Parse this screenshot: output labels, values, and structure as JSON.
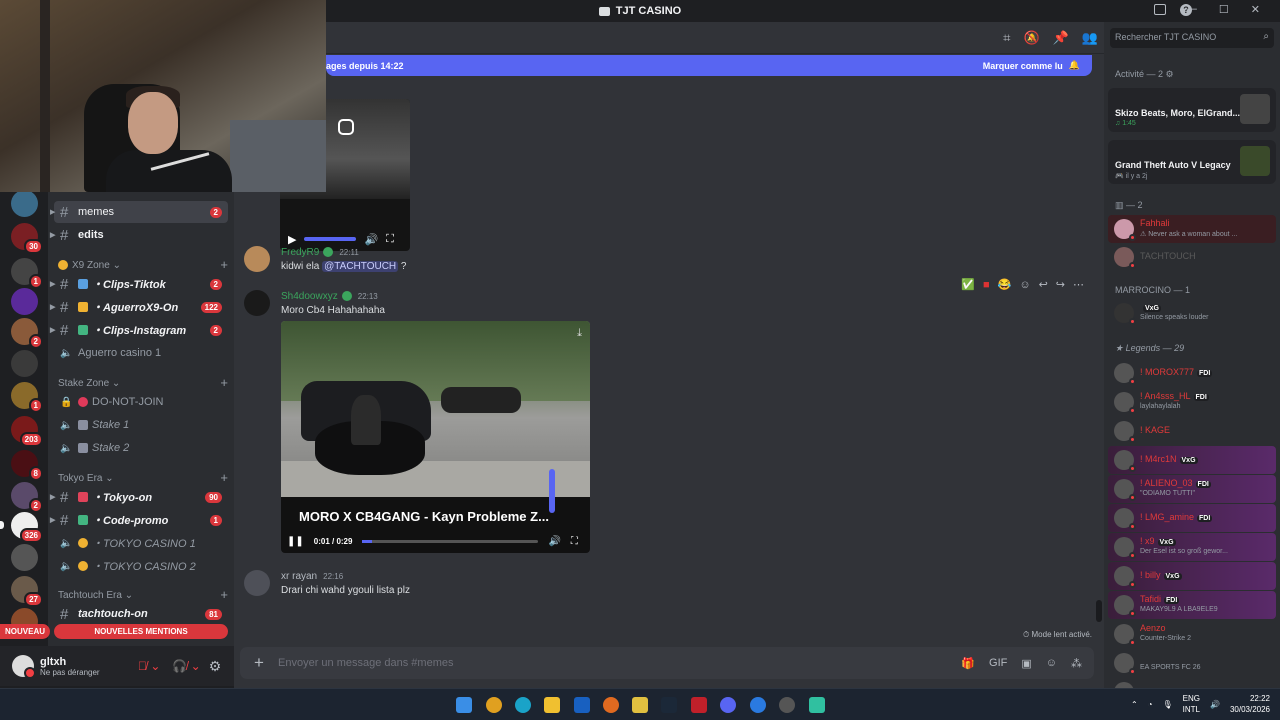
{
  "window": {
    "title": "TJT CASINO"
  },
  "channels": {
    "items": [
      {
        "label": "memes",
        "type": "text",
        "badge": "2",
        "selected": true
      },
      {
        "label": "edits",
        "type": "text",
        "badge": ""
      }
    ],
    "categories": [
      {
        "label": "X9 Zone"
      },
      {
        "label": "Stake Zone"
      },
      {
        "label": "Tokyo Era"
      },
      {
        "label": "Tachtouch Era"
      }
    ],
    "x9": [
      {
        "label": "・Clips-Tiktok",
        "badge": "2"
      },
      {
        "label": "・AguerroX9-On",
        "badge": "122"
      },
      {
        "label": "・Clips-Instagram",
        "badge": "2"
      },
      {
        "label": "Aguerro casino 1",
        "badge": ""
      }
    ],
    "stake": [
      {
        "label": "DO-NOT-JOIN"
      },
      {
        "label": "Stake 1"
      },
      {
        "label": "Stake 2"
      }
    ],
    "tokyo": [
      {
        "label": "・Tokyo-on",
        "badge": "90"
      },
      {
        "label": "・Code-promo",
        "badge": "1"
      },
      {
        "label": "・TOKYO CASINO 1"
      },
      {
        "label": "・TOKYO CASINO 2"
      }
    ],
    "tach": [
      {
        "label": "tachtouch-on",
        "badge": "81"
      }
    ],
    "new_label": "NOUVEAU",
    "mentions_label": "NOUVELLES MENTIONS"
  },
  "servers": {
    "badges": [
      "30",
      "1",
      "2",
      "1",
      "203",
      "8",
      "2",
      "326",
      "27"
    ]
  },
  "user": {
    "name": "gltxh",
    "status": "Ne pas déranger"
  },
  "chat": {
    "new_messages_banner": "ages depuis 14:22",
    "mark_read": "Marquer comme lu",
    "messages": [
      {
        "author": "FredyR9",
        "time": "22:11",
        "text_prefix": "kidwi ela ",
        "mention": "@TACHTOUCH",
        "text_suffix": " ?"
      },
      {
        "author": "Sh4doowxyz",
        "time": "22:13",
        "text": "Moro Cb4 Hahahahaha"
      },
      {
        "author": "xr rayan",
        "time": "22:16",
        "text": "Drari chi wahd ygouli lista plz"
      }
    ],
    "video": {
      "title": "MORO X CB4GANG - Kayn Probleme  Z...",
      "time": "0:01 / 0:29"
    },
    "slow_mode": "Mode lent activé.",
    "composer_placeholder": "Envoyer un message dans #memes"
  },
  "members": {
    "search_placeholder": "Rechercher TJT CASINO",
    "activity_header": "Activité — 2",
    "activities": [
      {
        "name": "Skizo Beats, Moro, ElGrand...",
        "sub": "1:45"
      },
      {
        "name": "Grand Theft Auto V Legacy",
        "sub": "il y a 2j"
      }
    ],
    "group2_header": "— 2",
    "group2": [
      {
        "name": "Fahhali",
        "sub": "Never ask a woman about ..."
      },
      {
        "name": "TACHTOUCH",
        "sub": ""
      }
    ],
    "marrocino_header": "MARROCINO — 1",
    "marrocino": [
      {
        "name": "",
        "tag": "VxG",
        "sub": "Silence speaks louder"
      }
    ],
    "legends_header": "Legends — 29",
    "legends": [
      {
        "name": "! MOROX777",
        "tag": "FDI",
        "sub": "",
        "color": "#e03a3a"
      },
      {
        "name": "! An4sss_HL",
        "tag": "FDI",
        "sub": "laylahaylalah",
        "color": "#e03a3a"
      },
      {
        "name": "! KAGE",
        "tag": "",
        "sub": "",
        "color": "#e03a3a"
      },
      {
        "name": "! M4rc1N",
        "tag": "VxG",
        "sub": "",
        "color": "#e03a3a"
      },
      {
        "name": "! ALIENO_03",
        "tag": "FDI",
        "sub": "\"ODIAMO TUTTI\"",
        "color": "#e03a3a"
      },
      {
        "name": "! LMG_amine",
        "tag": "FDI",
        "sub": "",
        "color": "#e03a3a"
      },
      {
        "name": "! x9",
        "tag": "VxG",
        "sub": "Der Esel ist so groß gewor...",
        "color": "#e03a3a"
      },
      {
        "name": "! billy",
        "tag": "VxG",
        "sub": "",
        "color": "#e03a3a"
      },
      {
        "name": "Tafidi",
        "tag": "FDI",
        "sub": "MAKAY9L9 A LBA9ELE9",
        "color": "#e03a3a"
      },
      {
        "name": "Aenzo",
        "tag": "",
        "sub": "Counter-Strike 2",
        "color": "#e03a3a"
      },
      {
        "name": "",
        "tag": "",
        "sub": "EA SPORTS FC 26",
        "color": "#e03a3a"
      },
      {
        "name": "",
        "tag": "VxG",
        "sub": "",
        "color": "#e03a3a"
      }
    ]
  },
  "taskbar": {
    "lang1": "ENG",
    "lang2": "INTL",
    "time": "22:22",
    "date": "30/03/2026"
  }
}
